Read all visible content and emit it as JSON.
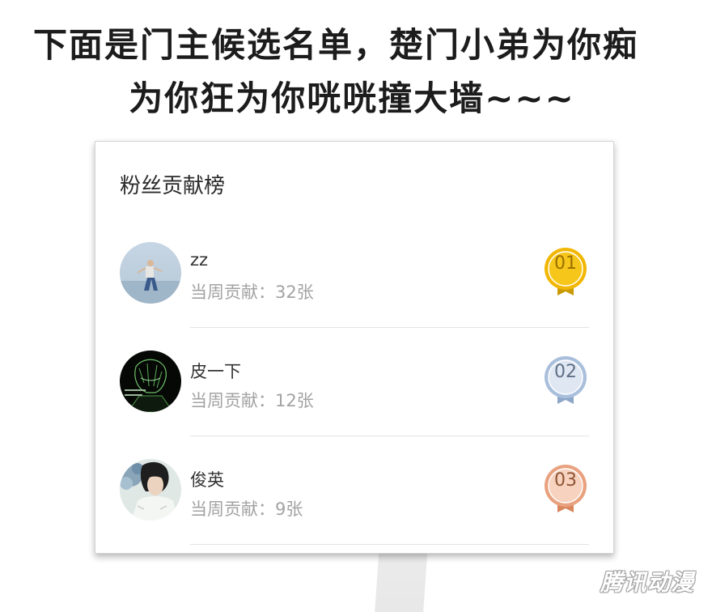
{
  "headline": {
    "line1": "下面是门主候选名单，楚门小弟为你痴",
    "line2": "为你狂为你咣咣撞大墙~~~"
  },
  "card": {
    "title": "粉丝贡献榜",
    "rows": [
      {
        "name": "zz",
        "contribution": "当周贡献：32张",
        "rank": "01",
        "medal": "gold-medal-icon",
        "medal_color": "#f2b705",
        "avatar": "person-on-beach-avatar"
      },
      {
        "name": "皮一下",
        "contribution": "当周贡献：12张",
        "rank": "02",
        "medal": "silver-medal-icon",
        "medal_color": "#a9bfdc",
        "avatar": "anime-character-avatar"
      },
      {
        "name": "俊英",
        "contribution": "当周贡献：9张",
        "rank": "03",
        "medal": "bronze-medal-icon",
        "medal_color": "#e9a27f",
        "avatar": "person-with-flowers-avatar"
      }
    ]
  },
  "watermark": "腾讯动漫"
}
